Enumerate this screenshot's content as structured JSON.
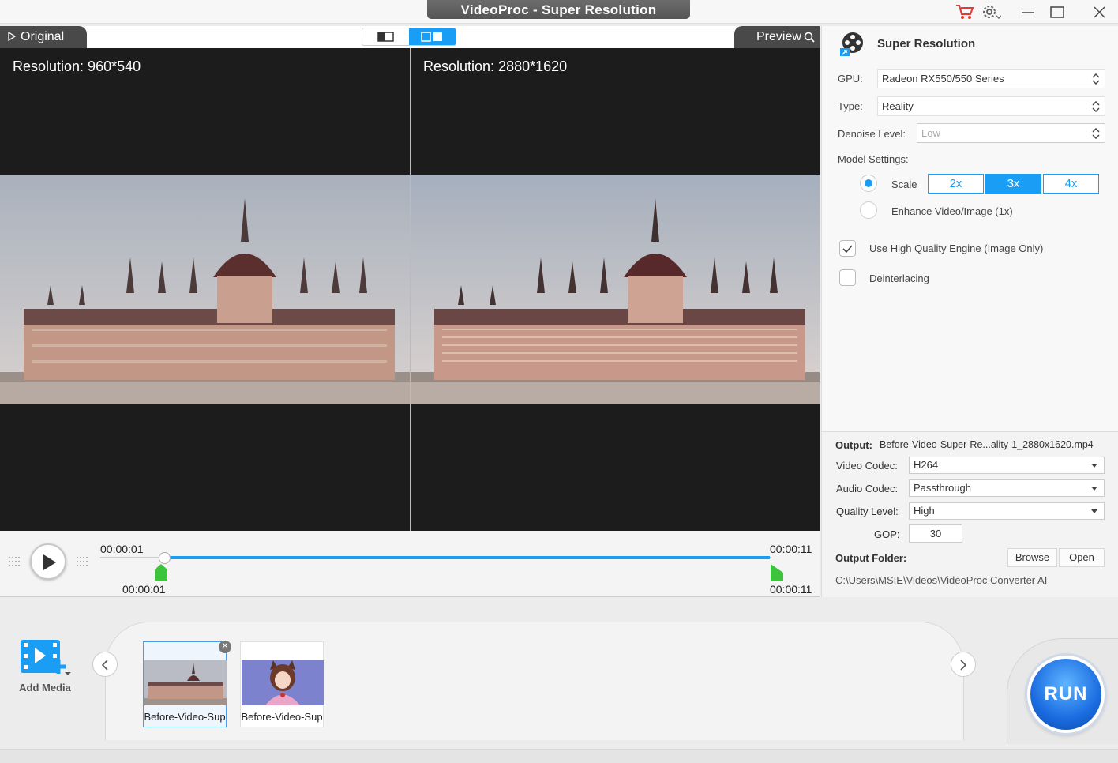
{
  "window": {
    "title": "VideoProc -  Super Resolution"
  },
  "preview": {
    "original_tab": "Original",
    "preview_tab": "Preview",
    "left_resolution": "Resolution: 960*540",
    "right_resolution": "Resolution: 2880*1620"
  },
  "playback": {
    "time_start_top": "00:00:01",
    "time_end_top": "00:00:11",
    "time_start_bottom": "00:00:01",
    "time_end_bottom": "00:00:11",
    "progress_fraction": 0.1
  },
  "settings": {
    "title": "Super Resolution",
    "gpu_label": "GPU:",
    "gpu_value": "Radeon RX550/550 Series",
    "type_label": "Type:",
    "type_value": "Reality",
    "denoise_label": "Denoise Level:",
    "denoise_value": "Low",
    "model_settings_label": "Model Settings:",
    "scale_label": "Scale",
    "scale_options": [
      "2x",
      "3x",
      "4x"
    ],
    "scale_selected": "3x",
    "enhance_label": "Enhance Video/Image (1x)",
    "high_quality_label": "Use High Quality Engine (Image Only)",
    "high_quality_checked": true,
    "deinterlacing_label": "Deinterlacing",
    "deinterlacing_checked": false
  },
  "output": {
    "output_label": "Output:",
    "output_file": "Before-Video-Super-Re...ality-1_2880x1620.mp4",
    "video_codec_label": "Video Codec:",
    "video_codec": "H264",
    "audio_codec_label": "Audio Codec:",
    "audio_codec": "Passthrough",
    "quality_label": "Quality Level:",
    "quality": "High",
    "gop_label": "GOP:",
    "gop": "30",
    "folder_label": "Output Folder:",
    "browse": "Browse",
    "open": "Open",
    "folder_path": "C:\\Users\\MSIE\\Videos\\VideoProc Converter AI"
  },
  "media": {
    "add_media": "Add Media",
    "items": [
      {
        "name": "Before-Video-Sup"
      },
      {
        "name": "Before-Video-Sup"
      }
    ],
    "run": "RUN"
  },
  "colors": {
    "accent": "#1a9ef5",
    "run": "#1a6ce0",
    "trim_green": "#3cc43c"
  }
}
